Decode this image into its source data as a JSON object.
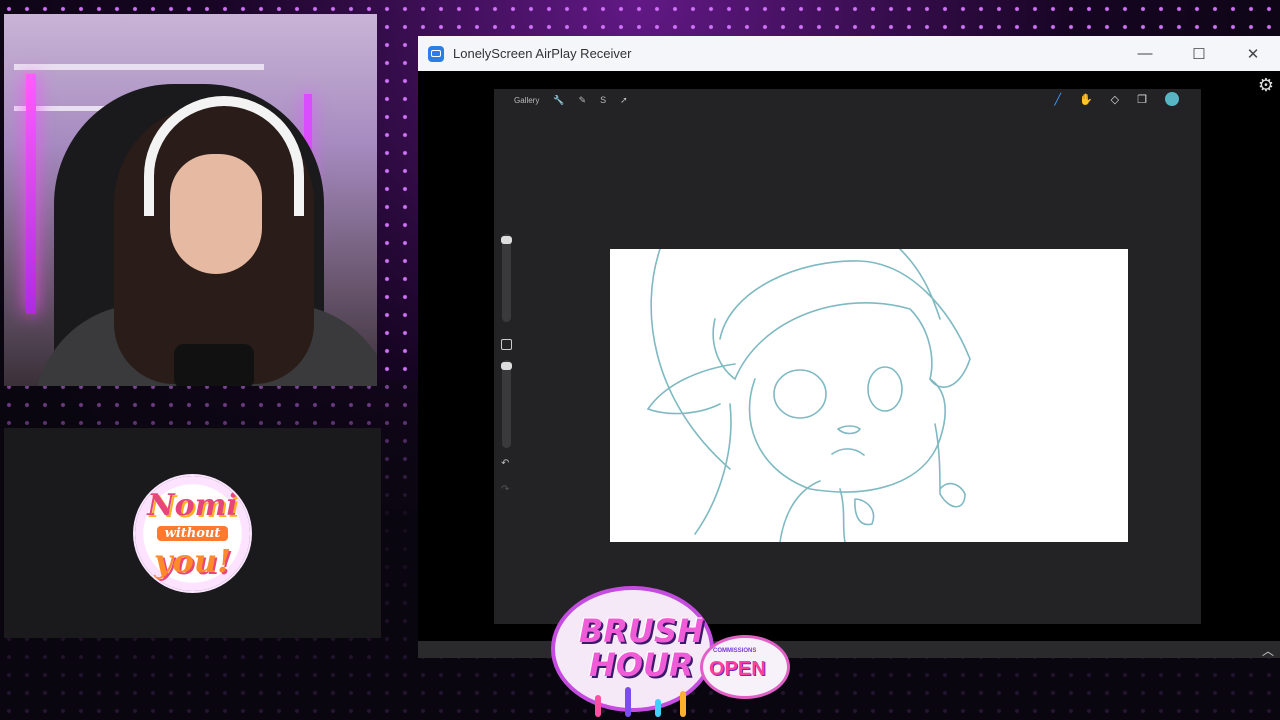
{
  "window": {
    "title": "LonelyScreen AirPlay Receiver",
    "minimize_glyph": "—",
    "maximize_glyph": "☐",
    "close_glyph": "✕",
    "settings_glyph": "⚙",
    "scroll_glyph": "︿"
  },
  "procreate": {
    "gallery_label": "Gallery",
    "left_tools": [
      "wrench-icon",
      "magic-wand-icon",
      "selection-icon",
      "transform-icon"
    ],
    "left_tool_glyphs": [
      "🔧",
      "✎",
      "S",
      "➚"
    ],
    "right_tools": [
      "brush-icon",
      "smudge-icon",
      "eraser-icon",
      "layers-icon"
    ],
    "right_tool_glyphs": [
      "╱",
      "✋",
      "◇",
      "❐"
    ],
    "active_tool": "brush-icon",
    "current_color": "#58b5c4",
    "undo_glyph": "↶",
    "redo_glyph": "↷"
  },
  "overlay": {
    "logo_line1": "Nomi",
    "logo_line2": "without",
    "logo_line3": "you!",
    "badge_line1": "BRUSH",
    "badge_line2": "HOUR",
    "badge_small": "COMMISSIONS",
    "badge_open": "OPEN"
  },
  "colors": {
    "accent_purple": "#b12ae0",
    "sketch_line": "#7fb9c2"
  }
}
